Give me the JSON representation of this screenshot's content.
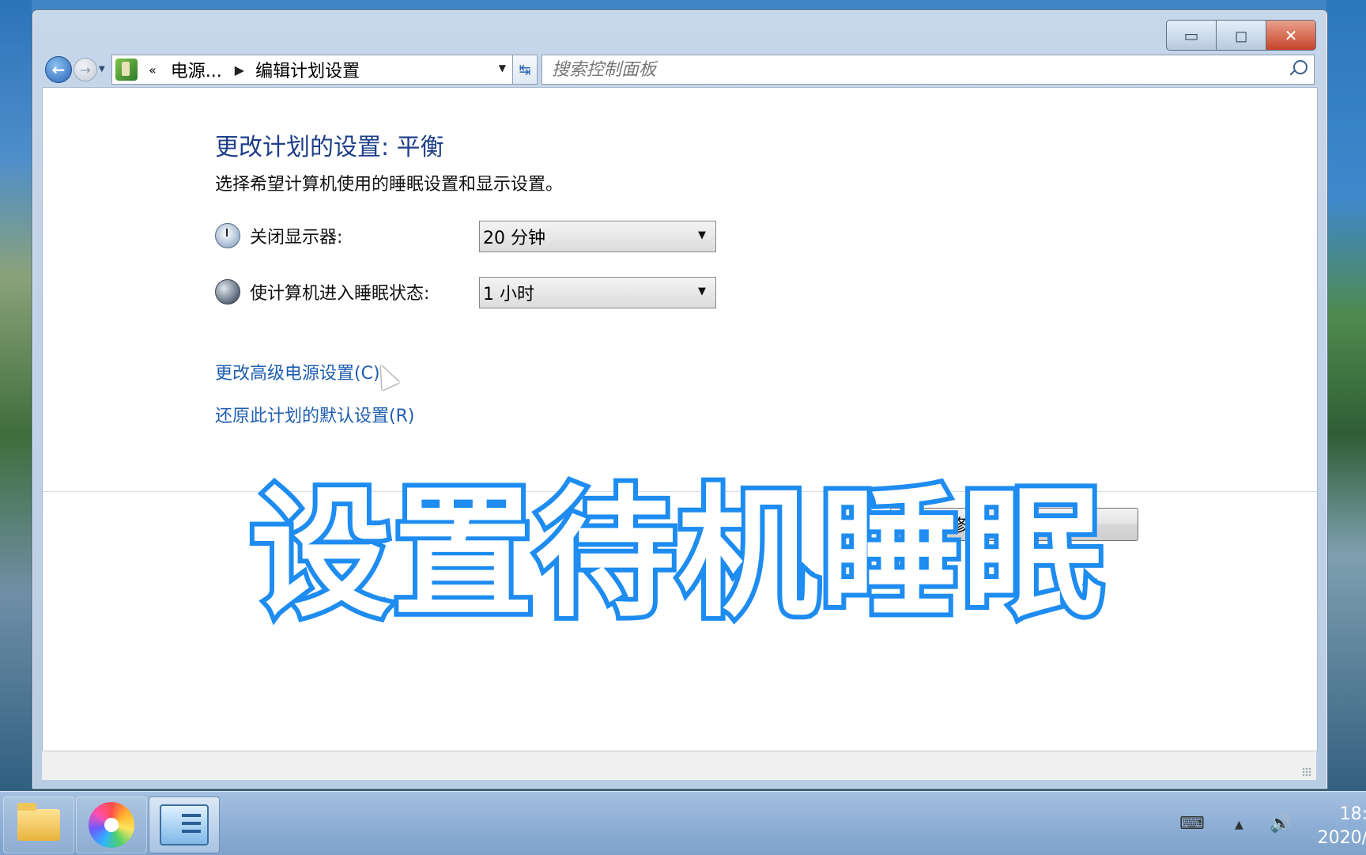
{
  "window": {
    "caption_buttons": {
      "minimize": "▭",
      "maximize": "◻",
      "close": "✕"
    },
    "nav": {
      "back_glyph": "←",
      "forward_glyph": "→",
      "breadcrumb_prefix": "«",
      "breadcrumb_parent": "电源...",
      "breadcrumb_current": "编辑计划设置",
      "refresh_glyph": "↹"
    },
    "search": {
      "placeholder": "搜索控制面板"
    }
  },
  "page": {
    "title": "更改计划的设置: 平衡",
    "subtitle": "选择希望计算机使用的睡眠设置和显示设置。",
    "display_off": {
      "label": "关闭显示器:",
      "value": "20 分钟"
    },
    "sleep": {
      "label": "使计算机进入睡眠状态:",
      "value": "1 小时"
    },
    "link_advanced": "更改高级电源设置(C)",
    "link_restore": "还原此计划的默认设置(R)",
    "save_button": "保存修改",
    "cancel_button": "取消"
  },
  "overlay_text": "设置待机睡眠",
  "taskbar": {
    "apps": [
      "folder-icon",
      "pinwheel-icon",
      "control-panel-icon"
    ],
    "clock_time": "18:",
    "clock_date": "2020/"
  },
  "colors": {
    "title": "#1e3f8a",
    "link": "#1f5fb0",
    "overlay_stroke": "#1e8cf0"
  }
}
